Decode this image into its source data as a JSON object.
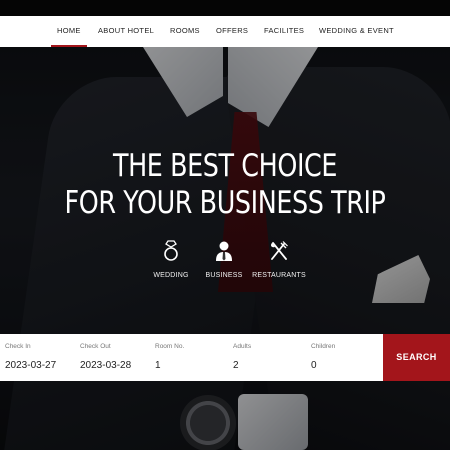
{
  "nav": {
    "items": [
      {
        "label": "HOME",
        "active": true
      },
      {
        "label": "ABOUT HOTEL"
      },
      {
        "label": "ROOMS"
      },
      {
        "label": "OFFERS"
      },
      {
        "label": "FACILITES"
      },
      {
        "label": "WEDDING & EVENT"
      }
    ]
  },
  "hero": {
    "headline_line1": "THE BEST CHOICE",
    "headline_line2": "FOR YOUR BUSINESS TRIP",
    "features": [
      {
        "icon": "ring-icon",
        "label": "WEDDING"
      },
      {
        "icon": "businessman-icon",
        "label": "BUSINESS"
      },
      {
        "icon": "fork-knife-icon",
        "label": "RESTAURANTS"
      }
    ]
  },
  "booking": {
    "check_in": {
      "label": "Check In",
      "value": "2023-03-27"
    },
    "check_out": {
      "label": "Check Out",
      "value": "2023-03-28"
    },
    "room_no": {
      "label": "Room No.",
      "value": "1"
    },
    "adults": {
      "label": "Adults",
      "value": "2"
    },
    "children": {
      "label": "Children",
      "value": "0"
    },
    "search_label": "SEARCH"
  },
  "colors": {
    "accent": "#a3151b",
    "nav_bg": "#ffffff",
    "top_bar": "#050505"
  }
}
